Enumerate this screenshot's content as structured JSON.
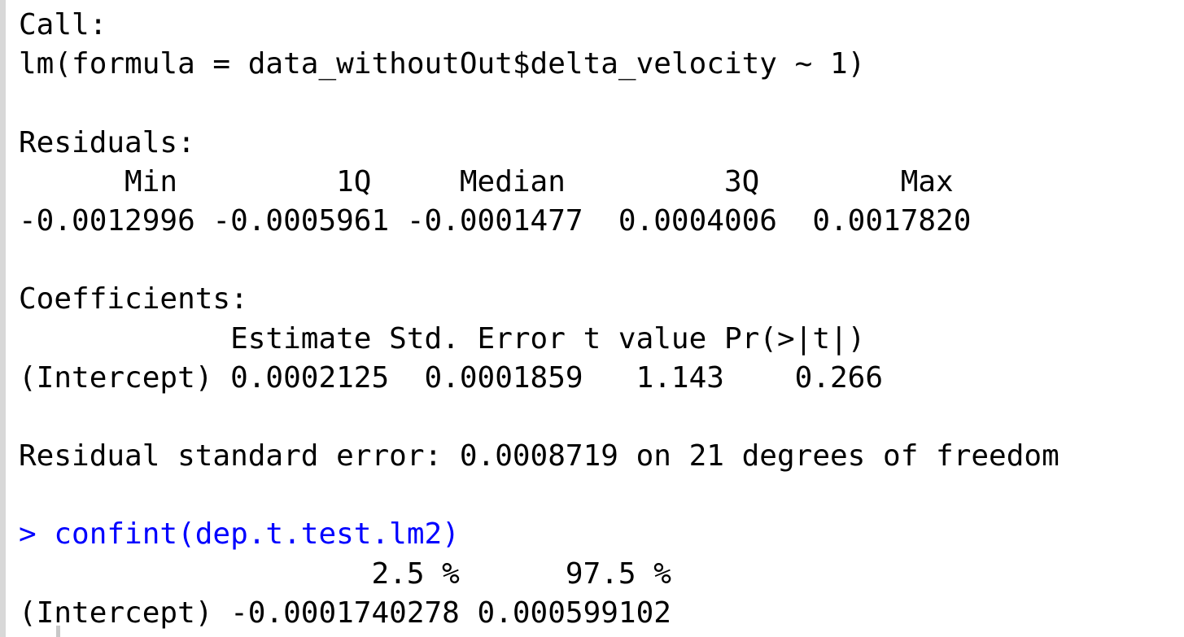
{
  "console": {
    "lines": [
      {
        "text": "Call:",
        "kind": "output"
      },
      {
        "text": "lm(formula = data_withoutOut$delta_velocity ~ 1)",
        "kind": "output"
      },
      {
        "text": "",
        "kind": "blank"
      },
      {
        "text": "Residuals:",
        "kind": "output"
      },
      {
        "text": "      Min         1Q     Median         3Q        Max ",
        "kind": "output"
      },
      {
        "text": "-0.0012996 -0.0005961 -0.0001477  0.0004006  0.0017820 ",
        "kind": "output"
      },
      {
        "text": "",
        "kind": "blank"
      },
      {
        "text": "Coefficients:",
        "kind": "output"
      },
      {
        "text": "            Estimate Std. Error t value Pr(>|t|)",
        "kind": "output"
      },
      {
        "text": "(Intercept) 0.0002125  0.0001859   1.143    0.266",
        "kind": "output"
      },
      {
        "text": "",
        "kind": "blank"
      },
      {
        "text": "Residual standard error: 0.0008719 on 21 degrees of freedom",
        "kind": "output"
      },
      {
        "text": "",
        "kind": "blank"
      },
      {
        "text": "> confint(dep.t.test.lm2)",
        "kind": "command"
      },
      {
        "text": "                    2.5 %      97.5 %",
        "kind": "output"
      },
      {
        "text": "(Intercept) -0.0001740278 0.000599102",
        "kind": "output"
      }
    ]
  },
  "colors": {
    "command": "#0000ff",
    "output": "#000000",
    "background": "#ffffff"
  }
}
